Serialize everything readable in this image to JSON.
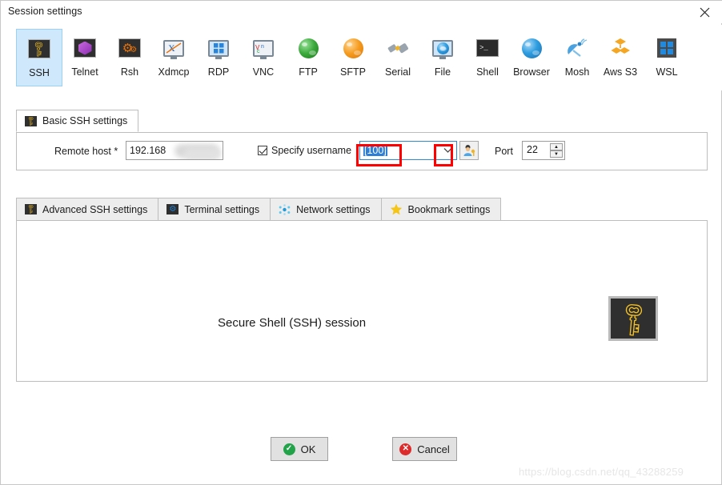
{
  "window": {
    "title": "Session settings",
    "close_icon": "close-icon"
  },
  "protocols": [
    {
      "label": "SSH",
      "icon": "ssh-key-icon",
      "selected": true
    },
    {
      "label": "Telnet",
      "icon": "telnet-cube-icon",
      "selected": false
    },
    {
      "label": "Rsh",
      "icon": "rsh-gears-icon",
      "selected": false
    },
    {
      "label": "Xdmcp",
      "icon": "xdmcp-monitor-icon",
      "selected": false
    },
    {
      "label": "RDP",
      "icon": "rdp-monitor-icon",
      "selected": false
    },
    {
      "label": "VNC",
      "icon": "vnc-monitor-icon",
      "selected": false
    },
    {
      "label": "FTP",
      "icon": "ftp-globe-icon",
      "selected": false
    },
    {
      "label": "SFTP",
      "icon": "sftp-globe-icon",
      "selected": false
    },
    {
      "label": "Serial",
      "icon": "serial-plug-icon",
      "selected": false
    },
    {
      "label": "File",
      "icon": "file-monitor-icon",
      "selected": false
    },
    {
      "label": "Shell",
      "icon": "shell-terminal-icon",
      "selected": false
    },
    {
      "label": "Browser",
      "icon": "browser-globe-icon",
      "selected": false
    },
    {
      "label": "Mosh",
      "icon": "mosh-satellite-icon",
      "selected": false
    },
    {
      "label": "Aws S3",
      "icon": "aws-s3-cubes-icon",
      "selected": false
    },
    {
      "label": "WSL",
      "icon": "wsl-windows-icon",
      "selected": false
    }
  ],
  "basic_tab": {
    "label": "Basic SSH settings",
    "icon": "key-icon"
  },
  "form": {
    "remote_host_label": "Remote host *",
    "remote_host_value": "192.168",
    "remote_host_redacted": true,
    "specify_username_label": "Specify username",
    "specify_username_checked": true,
    "username_value": "[100]",
    "username_selected": true,
    "username_dropdown_icon": "chevron-down-icon",
    "user_browse_icon": "user-key-icon",
    "port_label": "Port",
    "port_value": "22",
    "spin_up_icon": "spin-up-icon",
    "spin_down_icon": "spin-down-icon"
  },
  "settings_tabs": [
    {
      "label": "Advanced SSH settings",
      "icon": "key-icon",
      "active": false
    },
    {
      "label": "Terminal settings",
      "icon": "gear-icon",
      "active": false
    },
    {
      "label": "Network settings",
      "icon": "network-icon",
      "active": false
    },
    {
      "label": "Bookmark settings",
      "icon": "star-icon",
      "active": false
    }
  ],
  "content": {
    "title": "Secure Shell (SSH) session",
    "icon": "big-key-icon"
  },
  "footer": {
    "ok_label": "OK",
    "ok_icon": "check-circle-icon",
    "cancel_label": "Cancel",
    "cancel_icon": "x-circle-icon"
  },
  "watermark": "https://blog.csdn.net/qq_43288259",
  "colors": {
    "selected_tab_bg": "#cfe8fb",
    "annotation_red": "#ff0000",
    "selection_blue": "#2d7fd6",
    "combo_border": "#2e8ad4",
    "key_yellow": "#f7c325",
    "ok_green": "#22a34a",
    "cancel_red": "#dd2b2b"
  }
}
